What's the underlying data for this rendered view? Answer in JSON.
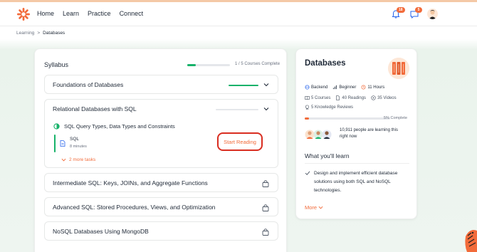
{
  "nav": {
    "links": [
      "Home",
      "Learn",
      "Practice",
      "Connect"
    ],
    "notifications_count": "18",
    "messages_count": "5",
    "icons": [
      "logo-icon",
      "bell-icon",
      "chat-icon",
      "avatar"
    ]
  },
  "breadcrumb": {
    "parent": "Learning",
    "separator": ">",
    "current": "Databases"
  },
  "syllabus": {
    "title": "Syllabus",
    "progress_text": "1 / 5 Courses Complete",
    "progress_fraction": 0.2,
    "modules": [
      {
        "title": "Foundations of Databases",
        "state": "complete",
        "progress": 1.0
      },
      {
        "title": "Relational Databases with SQL",
        "state": "expanded",
        "progress": 0.0,
        "sub_title": "SQL Query Types, Data Types and Constraints",
        "item_name": "SQL",
        "item_meta": "8 minutes",
        "start_label": "Start Reading",
        "more_tasks": "2 more tasks"
      },
      {
        "title": "Intermediate SQL: Keys, JOINs, and Aggregate Functions",
        "state": "locked"
      },
      {
        "title": "Advanced SQL: Stored Procedures, Views, and Optimization",
        "state": "locked"
      },
      {
        "title": "NoSQL Databases Using MongoDB",
        "state": "locked"
      }
    ]
  },
  "course": {
    "title": "Databases",
    "tags": [
      {
        "icon": "backend-icon",
        "label": "Backend"
      },
      {
        "icon": "level-icon",
        "label": "Beginner"
      },
      {
        "icon": "clock-icon",
        "label": "11 Hours"
      }
    ],
    "stats": [
      {
        "icon": "courses-icon",
        "label": "5 Courses"
      },
      {
        "icon": "readings-icon",
        "label": "40 Readings"
      },
      {
        "icon": "video-icon",
        "label": "35 Videos"
      }
    ],
    "reviews": {
      "icon": "reviews-icon",
      "label": "5 Knowledge Reviews"
    },
    "percent_complete_text": "5% Complete",
    "percent_complete": 0.05,
    "learners_text": "10,911 people are learning this right now",
    "learn_title": "What you'll learn",
    "learn_items": [
      "Design and implement efficient database solutions using both SQL and NoSQL technologies."
    ],
    "more_label": "More",
    "colors": {
      "accent": "#f26b3a",
      "success": "#17b26a",
      "highlight": "#d92d20"
    }
  }
}
